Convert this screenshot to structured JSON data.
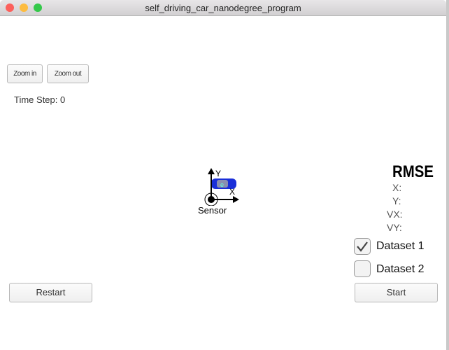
{
  "window": {
    "title": "self_driving_car_nanodegree_program"
  },
  "toolbar": {
    "zoom_in": "Zoom in",
    "zoom_out": "Zoom out"
  },
  "status": {
    "time_step": "Time Step: 0"
  },
  "scene": {
    "axis_x": "X",
    "axis_y": "Y",
    "sensor_label": "Sensor",
    "car_color": "#1a2fd8"
  },
  "rmse": {
    "title": "RMSE",
    "x": "X:",
    "y": "Y:",
    "vx": "VX:",
    "vy": "VY:"
  },
  "datasets": [
    {
      "label": "Dataset 1",
      "checked": true
    },
    {
      "label": "Dataset 2",
      "checked": false
    }
  ],
  "controls": {
    "restart": "Restart",
    "start": "Start"
  }
}
